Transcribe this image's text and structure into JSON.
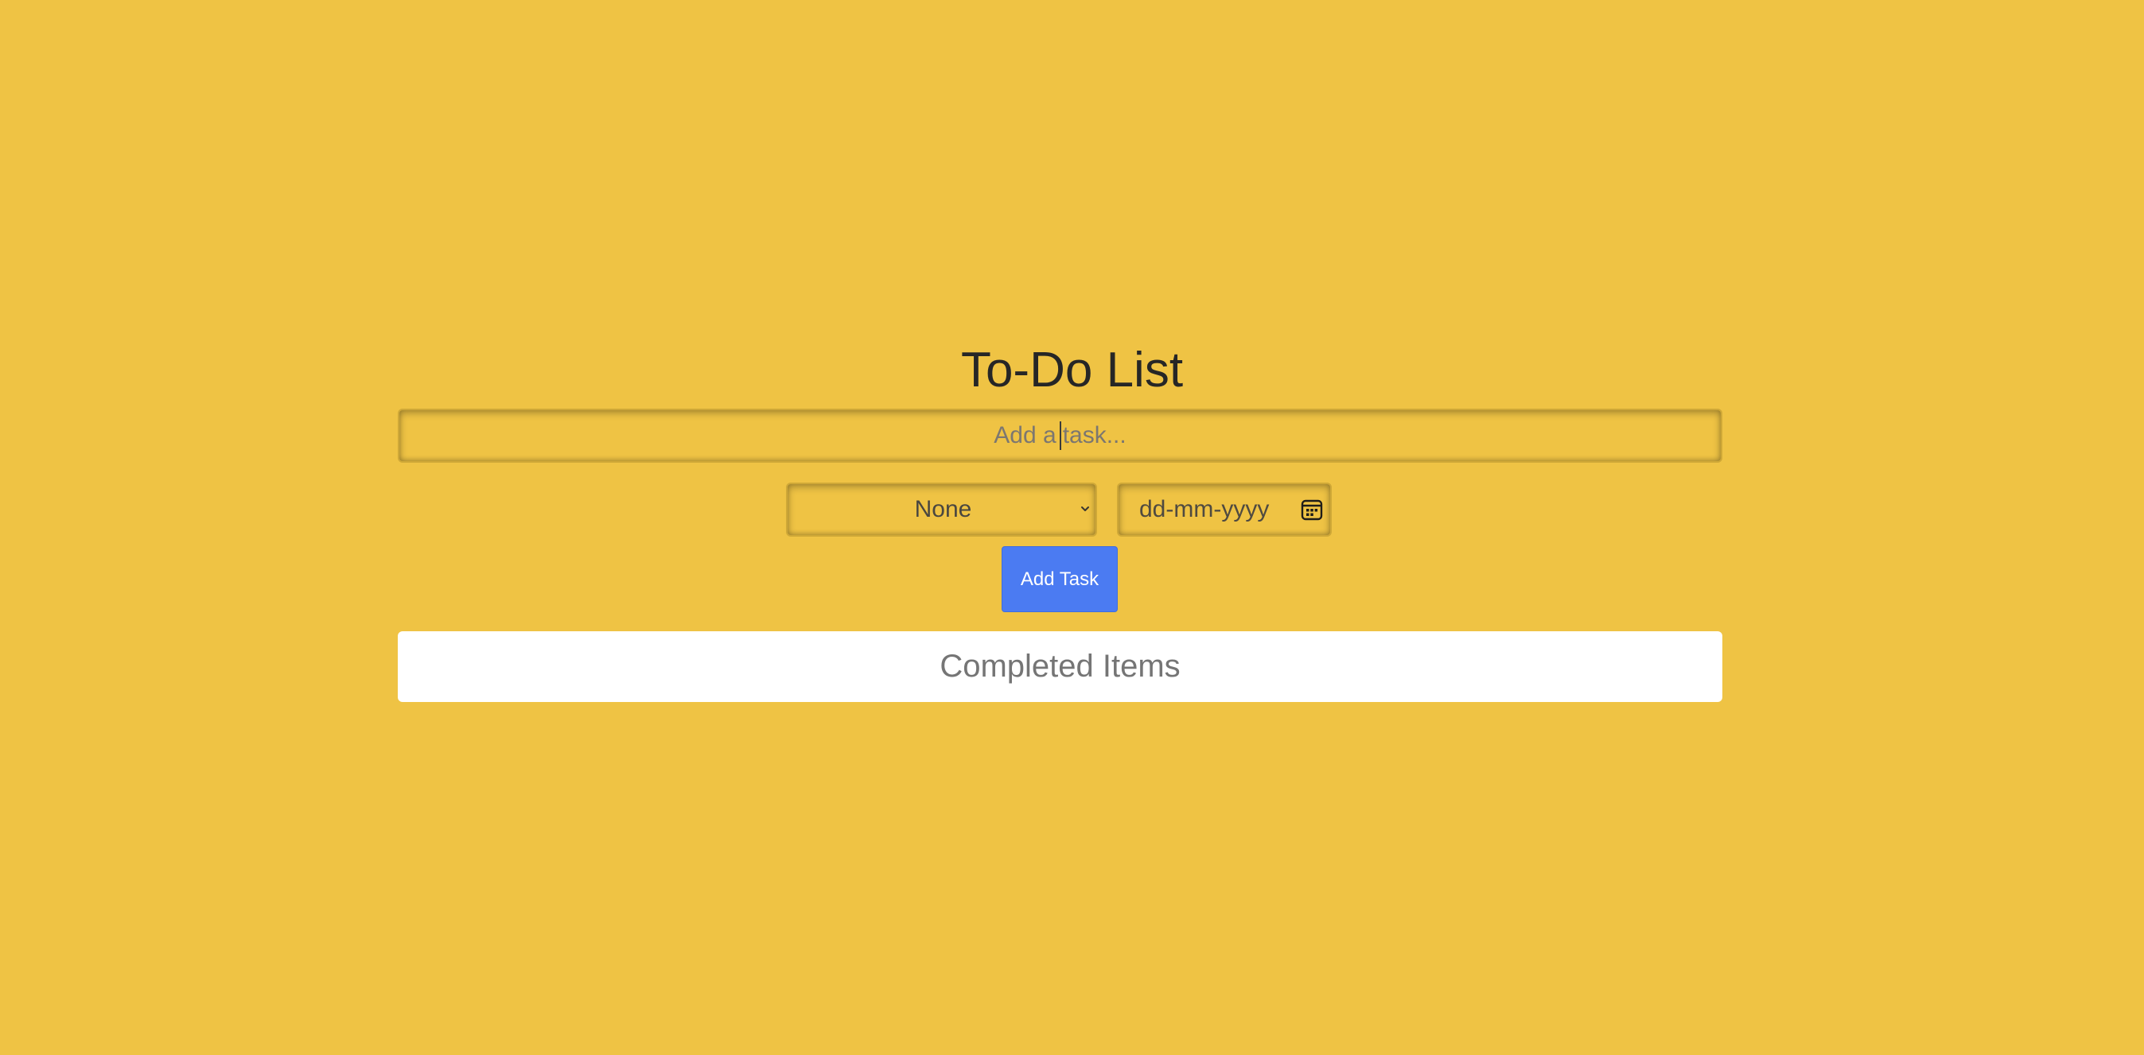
{
  "app": {
    "title": "To-Do List"
  },
  "task_input": {
    "placeholder_before_caret": "Add a",
    "placeholder_after_caret": "task..."
  },
  "priority_select": {
    "selected": "None"
  },
  "date_input": {
    "placeholder": "dd-mm-yyyy"
  },
  "add_button": {
    "label": "Add Task"
  },
  "completed_section": {
    "label": "Completed Items"
  },
  "colors": {
    "background": "#efc344",
    "button": "#4b7bf2",
    "panel": "#ffffff",
    "title_text": "#262626"
  },
  "icons": {
    "priority_dropdown": "chevron-down-icon",
    "date_picker": "calendar-icon"
  }
}
